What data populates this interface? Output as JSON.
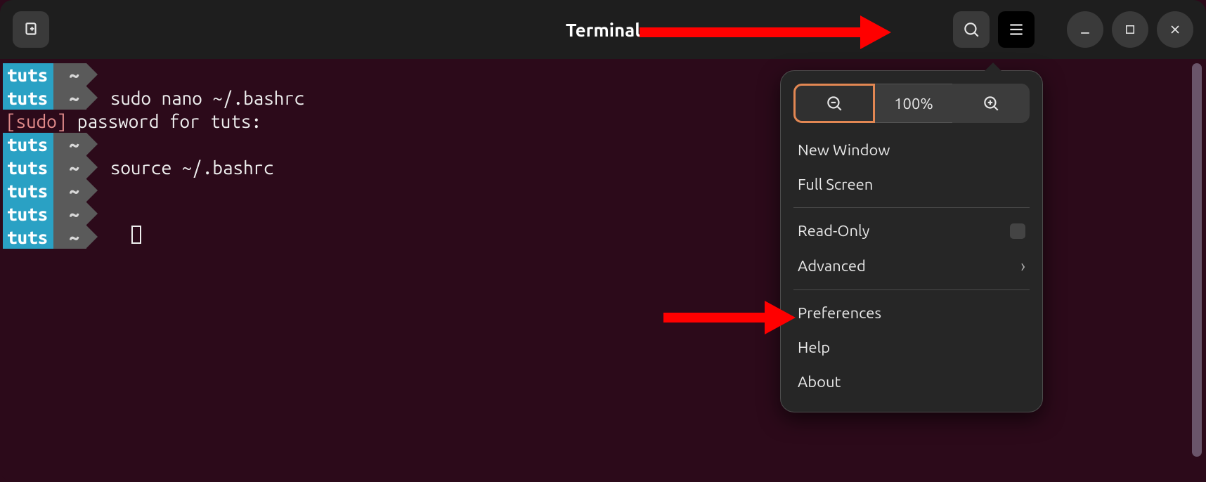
{
  "header": {
    "title": "Terminal"
  },
  "terminal": {
    "user": "tuts",
    "path": "~",
    "lines": [
      {
        "type": "prompt",
        "cmd": ""
      },
      {
        "type": "prompt",
        "cmd": "sudo nano ~/.bashrc"
      },
      {
        "type": "plain",
        "text_prefix": "[sudo]",
        "text_rest": " password for tuts:"
      },
      {
        "type": "prompt",
        "cmd": ""
      },
      {
        "type": "prompt",
        "cmd": "source ~/.bashrc"
      },
      {
        "type": "prompt",
        "cmd": ""
      },
      {
        "type": "prompt",
        "cmd": ""
      },
      {
        "type": "prompt",
        "cmd": "",
        "cursor": true
      }
    ]
  },
  "menu": {
    "zoom_level": "100%",
    "items": {
      "new_window": "New Window",
      "full_screen": "Full Screen",
      "read_only": "Read-Only",
      "advanced": "Advanced",
      "preferences": "Preferences",
      "help": "Help",
      "about": "About"
    }
  },
  "icons": {
    "new_tab": "new-tab",
    "search": "search",
    "hamburger": "hamburger",
    "minimize": "minimize",
    "maximize": "maximize",
    "close": "close",
    "zoom_out": "zoom-out",
    "zoom_in": "zoom-in",
    "chevron": "›"
  }
}
